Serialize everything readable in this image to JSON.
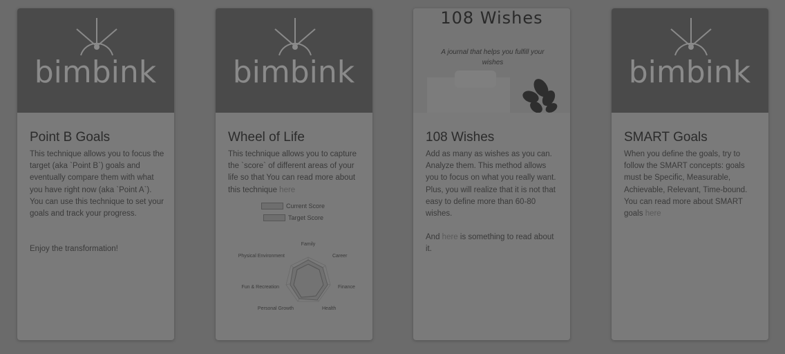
{
  "cards": [
    {
      "title": "Point B Goals",
      "logo_text": "bimbink",
      "paragraphs": [
        "This technique allows you to focus the target (aka `Point B`) goals and eventually compare them with what you have right now (aka `Point A`). You can use this technique to set your goals and track your progress.",
        "Enjoy the transformation!"
      ]
    },
    {
      "title": "Wheel of Life",
      "logo_text": "bimbink",
      "text_before_link": "This technique allows you to capture the `score` of different areas of your life so that You can read more about this technique ",
      "link": "here",
      "legend": [
        "Current Score",
        "Target Score"
      ],
      "radar_labels": [
        "Family",
        "Career",
        "Finance",
        "Health",
        "Personal Growth",
        "Fun & Recreation",
        "Physical Environment"
      ]
    },
    {
      "title": "108 Wishes",
      "header_title": "108 Wishes",
      "header_subtitle": "A journal that helps you fulfill your wishes",
      "paragraph1": "Add as many as wishes as you can. Analyze them. This method allows you to focus on what you really want. Plus, you will realize that it is not that easy to define more than 60-80 wishes.",
      "p2_before": "And ",
      "p2_link": "here",
      "p2_after": " is something to read about it."
    },
    {
      "title": "SMART Goals",
      "logo_text": "bimbink",
      "text_before_link": "When you define the goals, try to follow the SMART concepts: goals must be Specific, Measurable, Achievable, Relevant, Time-bound. You can read more about SMART goals ",
      "link": "here"
    }
  ],
  "colors": {
    "overlay_bg": "#6b6b6b",
    "card_bg": "#7a7a7a",
    "header_bg": "#4a4a4a",
    "logo_fg": "#8a8a8a"
  }
}
